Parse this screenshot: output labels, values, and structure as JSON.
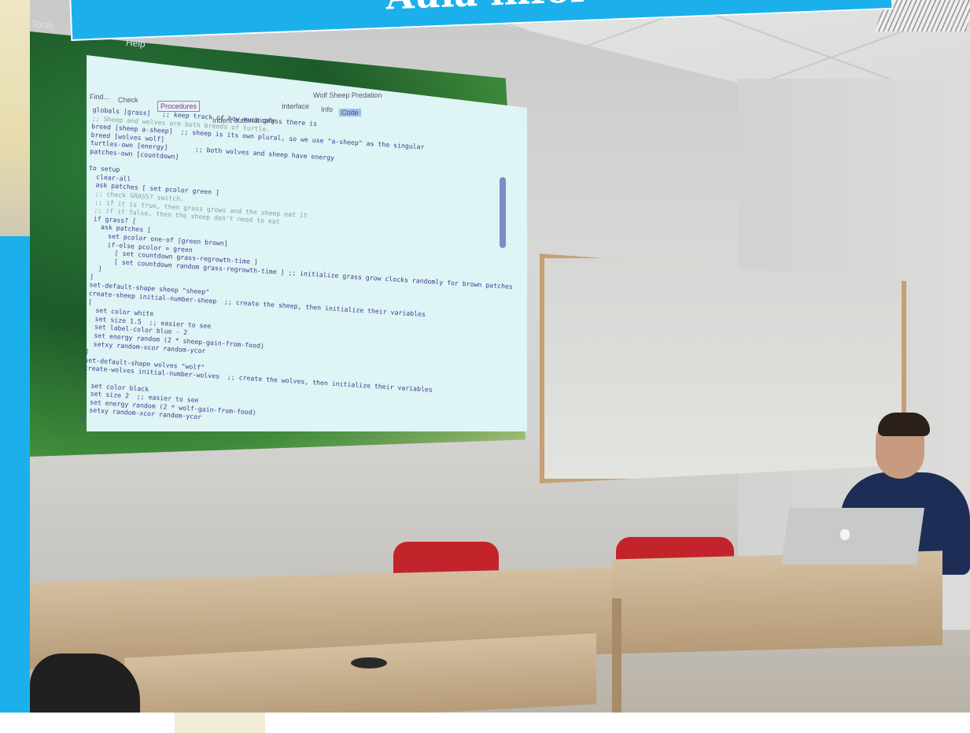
{
  "banner": {
    "title": "Aula infor"
  },
  "projected_app": {
    "menu": [
      "Tools",
      "Help"
    ],
    "toolbar": {
      "find_label": "Find...",
      "check_label": "Check",
      "procedures_label": "Procedures",
      "indent_label": "Indent automatically",
      "tabs": [
        "Interface",
        "Info",
        "Code"
      ],
      "window_title": "Wolf Sheep Predation"
    },
    "code_lines": [
      "globals [grass]   ;; keep track of how much grass there is",
      ";; Sheep and wolves are both breeds of turtle.",
      "breed [sheep a-sheep]  ;; sheep is its own plural, so we use \"a-sheep\" as the singular",
      "breed [wolves wolf]",
      "turtles-own [energy]       ;; both wolves and sheep have energy",
      "patches-own [countdown]",
      "",
      "to setup",
      "  clear-all",
      "  ask patches [ set pcolor green ]",
      "  ;; check GRASS? switch.",
      "  ;; if it is true, then grass grows and the sheep eat it",
      "  ;; if it false, then the sheep don't need to eat",
      "  if grass? [",
      "    ask patches [",
      "      set pcolor one-of [green brown]",
      "      if-else pcolor = green",
      "        [ set countdown grass-regrowth-time ]",
      "        [ set countdown random grass-regrowth-time ] ;; initialize grass grow clocks randomly for brown patches",
      "    ]",
      "  ]",
      "  set-default-shape sheep \"sheep\"",
      "  create-sheep initial-number-sheep  ;; create the sheep, then initialize their variables",
      "  [",
      "    set color white",
      "    set size 1.5  ;; easier to see",
      "    set label-color blue - 2",
      "    set energy random (2 * sheep-gain-from-food)",
      "    setxy random-xcor random-ycor",
      "  ]",
      "  set-default-shape wolves \"wolf\"",
      "  create-wolves initial-number-wolves  ;; create the wolves, then initialize their variables",
      "  [",
      "    set color black",
      "    set size 2  ;; easier to see",
      "    set energy random (2 * wolf-gain-from-food)",
      "    setxy random-xcor random-ycor",
      "  ]"
    ]
  },
  "colors": {
    "frame": "#1bb0ec",
    "code_text": "#3a3f8f",
    "chair": "#c3242b"
  }
}
